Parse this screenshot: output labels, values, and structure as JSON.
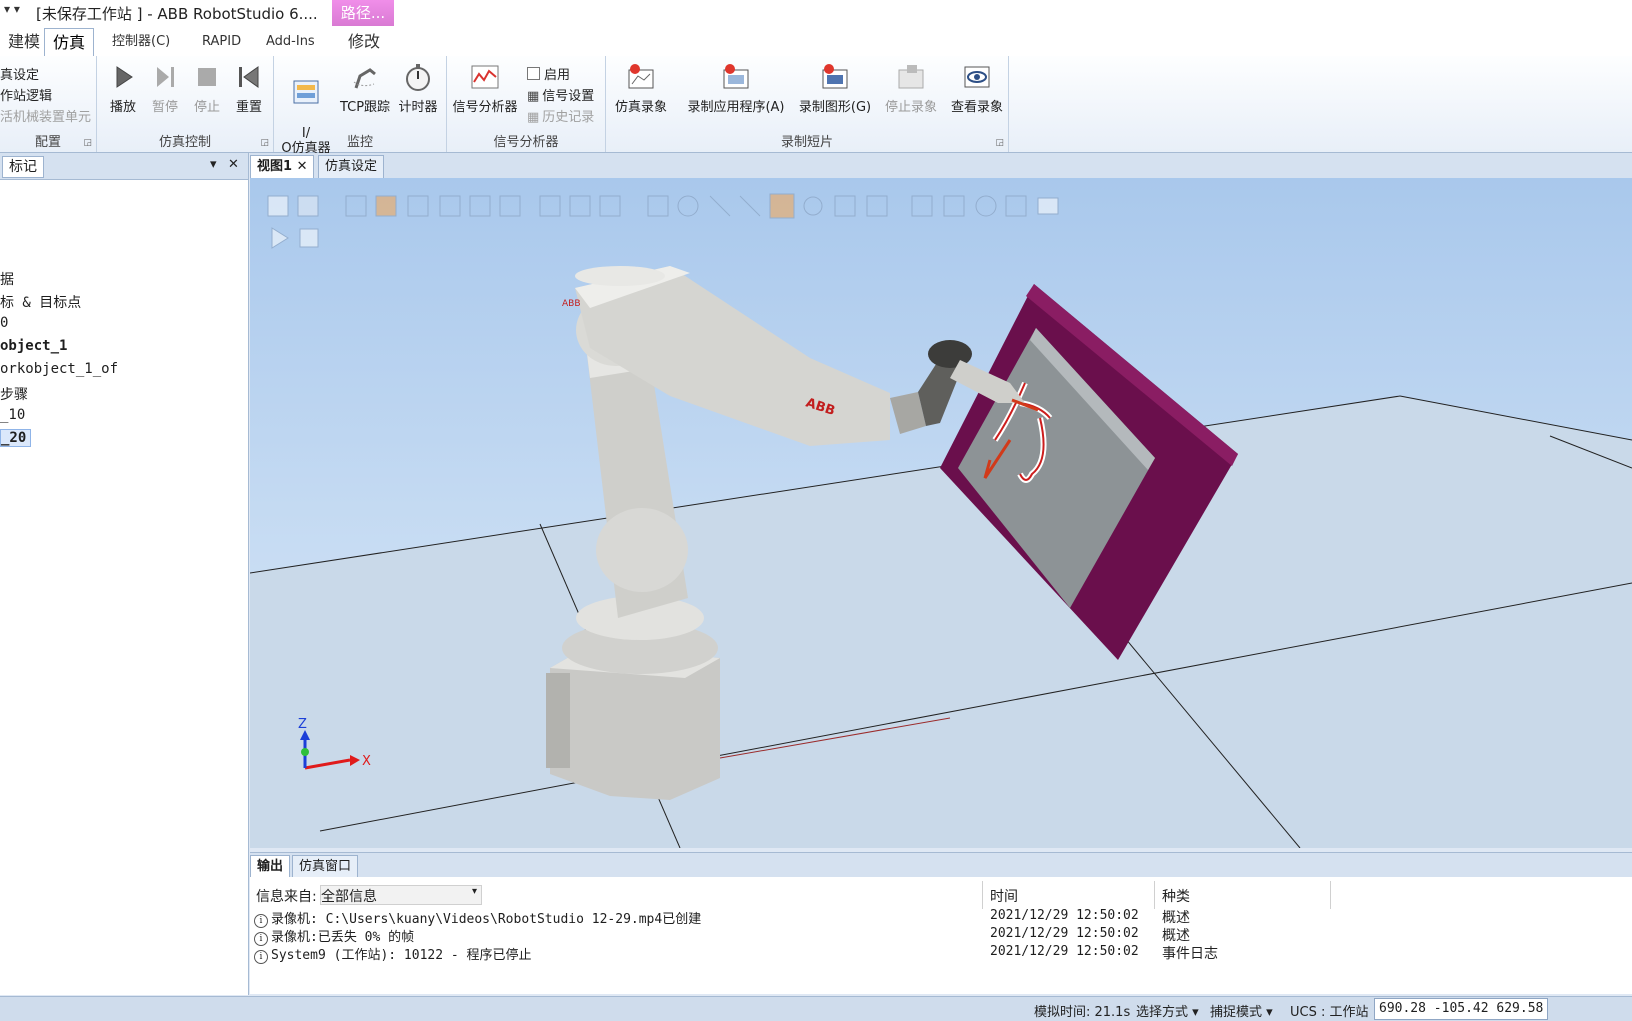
{
  "window": {
    "quick_access": "▾ ▾",
    "title": "[未保存工作站 ] - ABB RobotStudio 6....",
    "context_tab_title": "路径..."
  },
  "tabs": [
    {
      "label": "建模"
    },
    {
      "label": "仿真"
    },
    {
      "label": "控制器(C)"
    },
    {
      "label": "RAPID"
    },
    {
      "label": "Add-Ins"
    },
    {
      "label": "修改"
    }
  ],
  "ribbon": {
    "config": {
      "items": [
        "真设定",
        "作站逻辑",
        "活机械装置单元"
      ],
      "label": "配置"
    },
    "sim_control": {
      "play": "播放",
      "pause": "暂停",
      "stop": "停止",
      "reset": "重置",
      "label": "仿真控制"
    },
    "monitor": {
      "io_sim": "I/\nO仿真器",
      "tcp_trace": "TCP跟踪",
      "timer": "计时器",
      "label": "监控"
    },
    "signal": {
      "analyzer": "信号分析器",
      "enable": "启用",
      "settings": "信号设置",
      "history": "历史记录",
      "label": "信号分析器"
    },
    "record": {
      "sim_record": "仿真录象",
      "record_app": "录制应用程序(A)",
      "record_graphics": "录制图形(G)",
      "stop_record": "停止录象",
      "view_record": "查看录象",
      "label": "录制短片"
    }
  },
  "left_panel": {
    "tab": "标记",
    "tree": [
      "据",
      "标 & 目标点",
      "0",
      "object_1",
      "orkobject_1_of",
      "步骤",
      "_10",
      "_20"
    ]
  },
  "doc_tabs": {
    "view": "视图1",
    "sim_settings": "仿真设定"
  },
  "viewport": {
    "robot_brand": "ABB",
    "axis_x": "X",
    "axis_z": "Z"
  },
  "output": {
    "tabs": [
      "输出",
      "仿真窗口"
    ],
    "filter_label": "信息来自:",
    "filter_value": "全部信息",
    "col_time": "时间",
    "col_kind": "种类",
    "rows": [
      {
        "msg": "录像机:  C:\\Users\\kuany\\Videos\\RobotStudio 12-29.mp4已创建",
        "time": "2021/12/29 12:50:02",
        "kind": "概述"
      },
      {
        "msg": "录像机:已丢失 0% 的帧",
        "time": "2021/12/29 12:50:02",
        "kind": "概述"
      },
      {
        "msg": "System9 (工作站): 10122 - 程序已停止",
        "time": "2021/12/29 12:50:02",
        "kind": "事件日志"
      }
    ]
  },
  "status": {
    "sim_time": "模拟时间: 21.1s",
    "select_mode": "选择方式 ▾",
    "snap_mode": "捕捉模式 ▾",
    "ucs": "UCS : 工作站",
    "coords": "690.28  -105.42  629.58"
  },
  "colors": {
    "context_tab": "#e884e1",
    "viewport_sky": "#b6d0ee",
    "floor": "#c9d9e9",
    "fixture": "#6a0f4c",
    "robot": "#d7d7d3"
  }
}
